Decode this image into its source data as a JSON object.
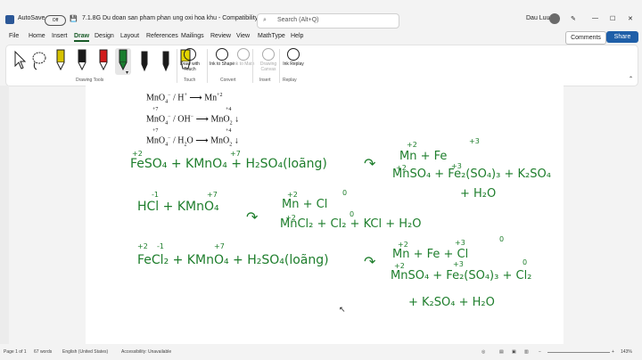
{
  "title_bar": {
    "autosave_label": "AutoSave",
    "autosave_state": "Off",
    "doc_title": "7.1.8G Du doan san pham phan ung oxi hoa khu  -  Compatibility Mode  -",
    "search_placeholder": "Search (Alt+Q)",
    "user_name": "Dau Luu"
  },
  "menu": {
    "tabs": [
      "File",
      "Home",
      "Insert",
      "Draw",
      "Design",
      "Layout",
      "References",
      "Mailings",
      "Review",
      "View",
      "MathType",
      "Help"
    ],
    "active_tab": "Draw",
    "comments_label": "Comments",
    "share_label": "Share"
  },
  "ribbon": {
    "group_drawing_tools": "Drawing Tools",
    "group_touch": "Touch",
    "group_convert": "Convert",
    "group_insert": "Insert",
    "group_replay": "Replay",
    "draw_with_touch": "Draw with Touch",
    "ink_to_shape": "Ink to Shape",
    "ink_to_math": "Ink to Math",
    "drawing_canvas": "Drawing Canvas",
    "ink_replay": "Ink Replay",
    "pen_colors": [
      "#d6c200",
      "#1a1a1a",
      "#d11c1c",
      "#1a7d2e",
      "#1a1a1a",
      "#1a1a1a",
      "#e3d400"
    ]
  },
  "document": {
    "printed": {
      "line1_lhs": "MnO",
      "line1_medium": " / H",
      "line1_rhs": "Mn",
      "line1_rhs_sup": "+2",
      "line2_ox": "+7",
      "line2_lhs": "MnO",
      "line2_medium": " / OH",
      "line2_rhs_ox": "+4",
      "line2_rhs": "MnO",
      "line3_ox": "+7",
      "line3_lhs": "MnO",
      "line3_medium": " / H",
      "line3_medium2": "O",
      "line3_rhs_ox": "+4",
      "line3_rhs": "MnO"
    },
    "handwriting": {
      "eq1_reactants": "FeSO₄  +  KMnO₄  +  H₂SO₄(loãng)",
      "eq1_product_line1": "Mn  +  Fe",
      "eq1_product_line2": "MnSO₄  +  Fe₂(SO₄)₃ + K₂SO₄",
      "eq1_product_line3": "+ H₂O",
      "eq2_reactants": "HCl +   KMnO₄",
      "eq2_product_line1": "Mn  +  Cl",
      "eq2_product_line2": "MnCl₂ + Cl₂ + KCl + H₂O",
      "eq3_reactants": "FeCl₂ +  KMnO₄  +  H₂SO₄(loãng)",
      "eq3_product_line1": "Mn  +  Fe  +  Cl",
      "eq3_product_line2": "MnSO₄ + Fe₂(SO₄)₃ + Cl₂",
      "eq3_product_line3": "+ K₂SO₄  +  H₂O",
      "ox_labels": [
        "+2",
        "+7",
        "+2",
        "+3",
        "+2",
        "+3",
        "-1",
        "+7",
        "+2",
        "0",
        "+2",
        "0",
        "+2",
        "-1",
        "+7",
        "+2",
        "+3",
        "0",
        "+2",
        "+3",
        "0"
      ]
    }
  },
  "status_bar": {
    "page": "Page 1 of 1",
    "words": "67 words",
    "language": "English (United States)",
    "accessibility": "Accessibility: Unavailable",
    "zoom": "143%"
  }
}
